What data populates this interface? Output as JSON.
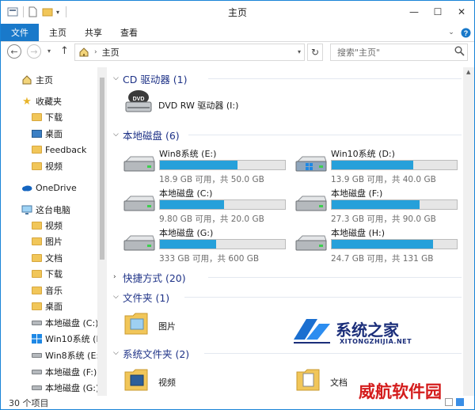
{
  "window": {
    "title": "主页",
    "buttons": {
      "minimize": "—",
      "maximize": "☐",
      "close": "✕"
    }
  },
  "ribbon": {
    "tabs": [
      "文件",
      "主页",
      "共享",
      "查看"
    ],
    "expand_icon": "chevron-down-icon",
    "help_icon": "help-icon"
  },
  "address": {
    "path": "主页",
    "search_placeholder": "搜索\"主页\""
  },
  "nav": {
    "home": "主页",
    "favorites": "收藏夹",
    "favorite_items": [
      "下载",
      "桌面",
      "Feedback",
      "视频"
    ],
    "onedrive": "OneDrive",
    "this_pc": "这台电脑",
    "pc_items": [
      "视频",
      "图片",
      "文档",
      "下载",
      "音乐",
      "桌面"
    ],
    "drives": [
      "本地磁盘 (C:)",
      "Win10系统 (D",
      "Win8系统 (E:)",
      "本地磁盘 (F:)",
      "本地磁盘 (G:)"
    ]
  },
  "groups": {
    "cd": "CD 驱动器 (1)",
    "local": "本地磁盘 (6)",
    "shortcuts": "快捷方式 (20)",
    "folders": "文件夹 (1)",
    "system_folders": "系统文件夹 (2)"
  },
  "cd_drive": {
    "name": "DVD RW 驱动器 (I:)",
    "badge": "DVD"
  },
  "drives": [
    {
      "name": "Win8系统 (E:)",
      "free": "18.9 GB 可用，共 50.0 GB",
      "used_fraction": 0.62
    },
    {
      "name": "Win10系统 (D:)",
      "free": "13.9 GB 可用，共 40.0 GB",
      "used_fraction": 0.65
    },
    {
      "name": "本地磁盘 (C:)",
      "free": "9.80 GB 可用，共 20.0 GB",
      "used_fraction": 0.51
    },
    {
      "name": "本地磁盘 (F:)",
      "free": "27.3 GB 可用，共 90.0 GB",
      "used_fraction": 0.7
    },
    {
      "name": "本地磁盘 (G:)",
      "free": "333 GB 可用，共 600 GB",
      "used_fraction": 0.45
    },
    {
      "name": "本地磁盘 (H:)",
      "free": "24.7 GB 可用，共 131 GB",
      "used_fraction": 0.81
    }
  ],
  "folders": {
    "pictures": "图片",
    "videos": "视频",
    "documents": "文档"
  },
  "status": {
    "count": "30 个项目"
  },
  "watermarks": {
    "site1_big": "系统之家",
    "site1_small": "XITONGZHIJIA.NET",
    "site2": "威航软件园"
  },
  "colors": {
    "accent": "#1979ca",
    "bar_fill": "#26a0da",
    "group_heading": "#1e3287"
  }
}
